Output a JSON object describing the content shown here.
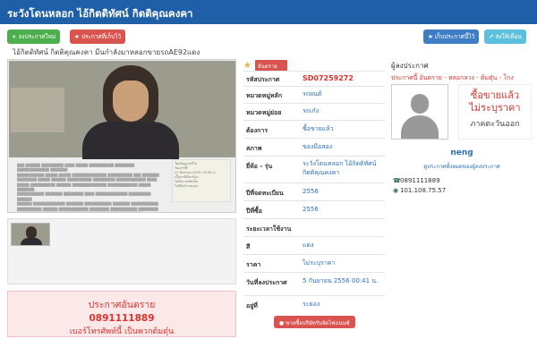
{
  "header": {
    "title": "ระวังโดนหลอก ไอ้กิตติทัศน์ กิตติคุณคงคา"
  },
  "toolbar": {
    "new_post_label": "ลงประกาศใหม่",
    "saved_posts_label": "ประกาศที่เก็บไว้",
    "save_post_label": "เก็บประกาศนี้ไว้",
    "share_label": "ส่งให้เพื่อน"
  },
  "listing": {
    "subtitle": "ไอ้กิตติทัศน์ กิตติคุณคงคา มีนกำลังมาหลอกขายรถAE92แดง",
    "type_badge": "อันตราย",
    "warning": {
      "title": "ประกาศอันตราย",
      "phone": "0891111889",
      "note": "เบอร์โทรศัพท์นี้ เป็นพวกต้มตุ๋น"
    },
    "details": [
      {
        "label": "รหัสประกาศ",
        "value": "SD07259272"
      },
      {
        "label": "หมวดหมู่หลัก",
        "value": "รถยนต์"
      },
      {
        "label": "หมวดหมู่ย่อย",
        "value": "รถเก๋ง"
      },
      {
        "label": "ต้องการ",
        "value": "ซื้อขายแล้ว"
      },
      {
        "label": "สภาพ",
        "value": "ของมือสอง"
      },
      {
        "label": "ยี่ห้อ - รุ่น",
        "value": "ระวังโดนหลอก ไอ้กิตติทัศน์ กิตติคุณคงคา"
      },
      {
        "label": "ปีที่จดทะเบียน",
        "value": "2556"
      },
      {
        "label": "ปีที่ซื้อ",
        "value": "2556"
      },
      {
        "label": "ระยะเวลาใช้งาน",
        "value": ""
      },
      {
        "label": "สี",
        "value": "แดง"
      },
      {
        "label": "ราคา",
        "value": "ไม่ระบุราคา"
      },
      {
        "label": "วันที่ลงประกาศ",
        "value": "5 กันยายน 2556 00:41 น."
      },
      {
        "label": "อยู่ที่",
        "value": "ระยอง"
      }
    ],
    "contact_button": "ขายซื้อบริษัทรับจัดไฟแนนซ์"
  },
  "poster": {
    "section_title": "ผู้ลงประกาศ",
    "links": "ประกาศนี้ อันตราย - หลอกลวง - ต้มตุ๋น - โกง",
    "status_line1": "ซื้อขายแล้ว",
    "status_line2": "ไม่ระบุราคา",
    "status_sub": "ภาคตะวันออก",
    "name": "neng",
    "more_link": "ดูประกาศทั้งหมดของผู้ลงประกาศ",
    "phone": "0891111889",
    "ip": "101.108.75.57"
  },
  "document": {
    "side_lines": [
      "โดยปัญญาทวีไอ",
      "วันเสาร์ที่",
      "21 สิงหาคม 2555, 05.00 น.",
      "",
      "เนื้อหาที่เกี่ยวข้อง",
      "ไม่มีความคิดเห็น",
      "ไม่มีลิงก์ภายนอก"
    ]
  },
  "colors": {
    "title_bar": "#1e5fa8",
    "accent_red": "#e0312c",
    "link_blue": "#2c6fb7"
  },
  "icons": [
    "plus-icon",
    "star-icon",
    "user-icon",
    "phone-icon",
    "globe-icon",
    "share-icon"
  ]
}
